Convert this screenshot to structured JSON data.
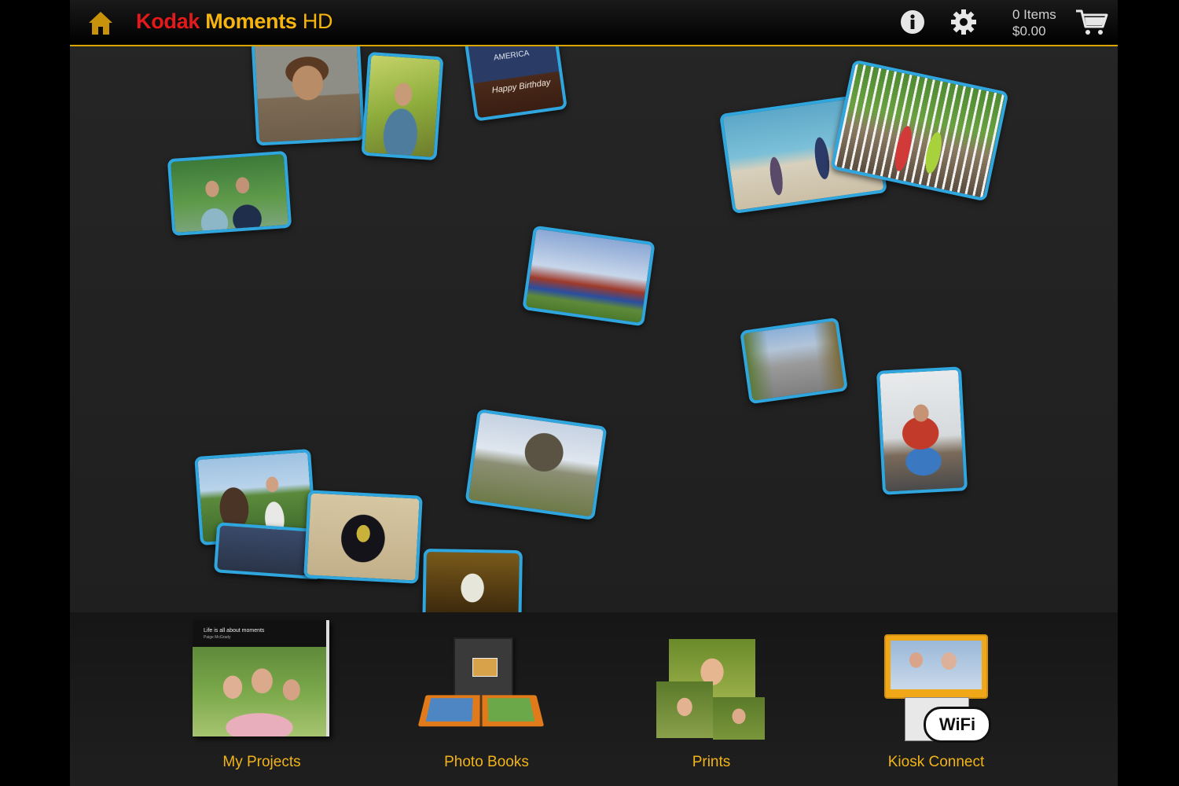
{
  "header": {
    "brand_kodak": "Kodak",
    "brand_moments": "Moments",
    "brand_hd": "HD",
    "cart_items": "0 Items",
    "cart_total": "$0.00"
  },
  "icons": {
    "home": "home-icon",
    "info": "info-icon",
    "settings": "gear-icon",
    "cart": "shopping-cart-icon"
  },
  "colors": {
    "accent": "#d9a400",
    "kodak_red": "#e3191b",
    "brand_yellow": "#f6b50e",
    "photo_frame": "#2fa6de",
    "label": "#f2b418"
  },
  "dock": {
    "my_projects": "My Projects",
    "photo_books": "Photo Books",
    "prints": "Prints",
    "kiosk_connect": "Kiosk Connect"
  },
  "book_cover": {
    "title": "Life is all about moments",
    "author": "Paige McGrady"
  },
  "shirt_text": "AMERICA",
  "cake_text": "Happy Birthday",
  "wifi_text": "WiFi"
}
